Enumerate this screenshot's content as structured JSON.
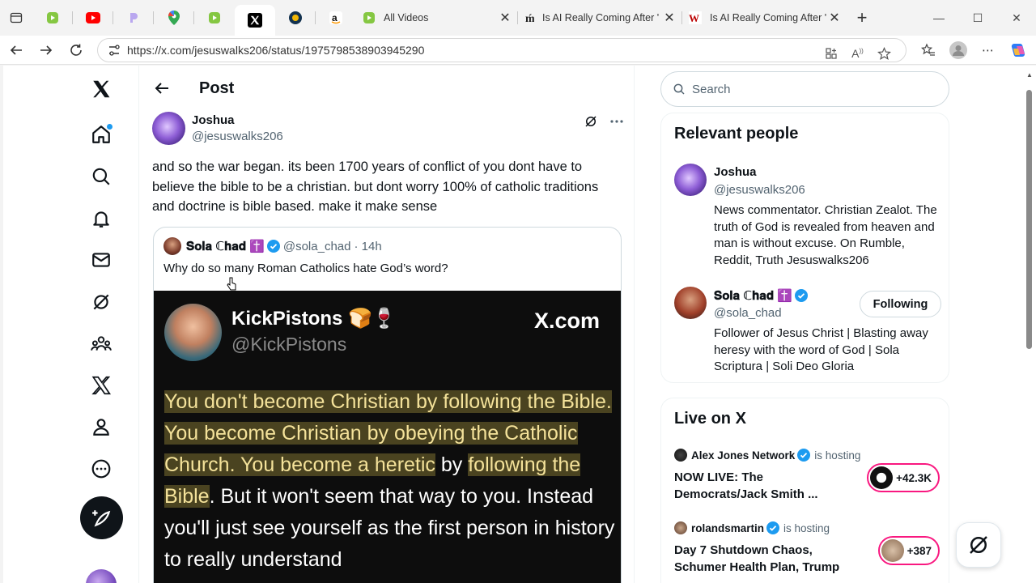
{
  "browser": {
    "tabs": [
      {
        "title": "All Videos"
      },
      {
        "title": "Is AI Really Coming After '"
      },
      {
        "title": "Is AI Really Coming After '"
      }
    ],
    "url": "https://x.com/jesuswalks206/status/1975798538903945290"
  },
  "header": {
    "title": "Post"
  },
  "post": {
    "author_name": "Joshua",
    "author_handle": "@jesuswalks206",
    "text": "and so the war began. its been 1700 years of conflict of you dont have to believe the bible to be a christian. but dont worry 100% of catholic traditions and doctrine is bible based. make it make sense",
    "quote": {
      "name": "𝐒𝐨𝐥𝐚 ℂ𝐡𝐚𝐝 ✝️",
      "handle": "@sola_chad",
      "time": "· 14h",
      "text": "Why do so many Roman Catholics hate God’s word?",
      "image": {
        "name": "KickPistons 🍞🍷",
        "handle": "@KickPistons",
        "brand": "X.com",
        "segments": [
          {
            "text": "You don't become Christian by following the Bible. You become Christian by obeying the Catholic Church. You become a heretic",
            "hl": true
          },
          {
            "text": " by ",
            "hl": false
          },
          {
            "text": "following the Bible",
            "hl": true
          },
          {
            "text": ". But it won't seem that way to you. Instead you'll just see yourself as the first person in history to really understand",
            "hl": false
          }
        ]
      }
    }
  },
  "search": {
    "placeholder": "Search"
  },
  "relevant": {
    "title": "Relevant people",
    "people": [
      {
        "name": "Joshua",
        "handle": "@jesuswalks206",
        "bio": "News commentator. Christian Zealot. The truth of God is revealed from heaven and man is without excuse. On Rumble, Reddit, Truth Jesuswalks206"
      },
      {
        "name": "𝐒𝐨𝐥𝐚 ℂ𝐡𝐚𝐝 ✝️",
        "handle": "@sola_chad",
        "bio": "Follower of Jesus Christ | Blasting away heresy with the word of God | Sola Scriptura | Soli Deo Gloria",
        "button": "Following"
      }
    ]
  },
  "live": {
    "title": "Live on X",
    "items": [
      {
        "host": "Alex Jones Network",
        "status": "is hosting",
        "title": "NOW LIVE: The Democrats/Jack Smith ...",
        "count": "+42.3K"
      },
      {
        "host": "rolandsmartin",
        "status": "is hosting",
        "title": "Day 7 Shutdown Chaos, Schumer Health Plan, Trump ...",
        "count": "+387"
      }
    ]
  },
  "colors": {
    "accent": "#1d9bf0",
    "live_ring": "#f91880",
    "text": "#0f1419",
    "muted": "#536471"
  }
}
